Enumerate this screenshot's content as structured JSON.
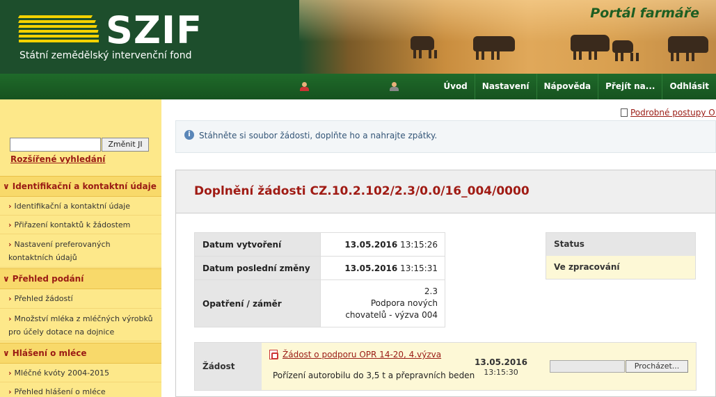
{
  "header": {
    "logo_text": "SZIF",
    "logo_subtitle": "Státní zemědělský intervenční fond",
    "portal_title": "Portál farmáře"
  },
  "nav": {
    "items": [
      "Úvod",
      "Nastavení",
      "Nápověda",
      "Přejít na...",
      "Odhlásit"
    ]
  },
  "sidebar": {
    "search_button": "Změnit JI",
    "search_value": "",
    "advanced_link": "Rozšířené vyhledání",
    "sections": [
      {
        "label": "Identifikační a kontaktní údaje",
        "links": [
          "Identifikační a kontaktní údaje",
          "Přiřazení kontaktů k žádostem",
          "Nastavení preferovaných kontaktních údajů"
        ]
      },
      {
        "label": "Přehled podání",
        "links": [
          "Přehled žádostí",
          "Množství mléka z mléčných výrobků pro účely dotace na dojnice"
        ]
      },
      {
        "label": "Hlášení o mléce",
        "links": [
          "Mléčné kvóty 2004-2015",
          "Přehled hlášení o mléce"
        ]
      }
    ]
  },
  "main": {
    "help_link": "Podrobné postupy OPR",
    "info_text": "Stáhněte si soubor žádosti, doplňte ho a nahrajte zpátky.",
    "title": "Doplnění žádosti CZ.10.2.102/2.3/0.0/16_004/0000",
    "details": {
      "created_label": "Datum vytvoření",
      "created_date": "13.05.2016",
      "created_time": "13:15:26",
      "changed_label": "Datum poslední změny",
      "changed_date": "13.05.2016",
      "changed_time": "13:15:31",
      "measure_label": "Opatření / záměr",
      "measure_code": "2.3",
      "measure_text": "Podpora nových chovatelů - výzva 004"
    },
    "status": {
      "label": "Status",
      "value": "Ve zpracování"
    },
    "document": {
      "label": "Žádost",
      "file_link": "Žádost o podporu OPR 14-20, 4.výzva",
      "description": "Pořízení autorobilu do 3,5 t a přepravních beden",
      "date": "13.05.2016",
      "time": "13:15:30",
      "browse_button": "Procházet..."
    }
  }
}
